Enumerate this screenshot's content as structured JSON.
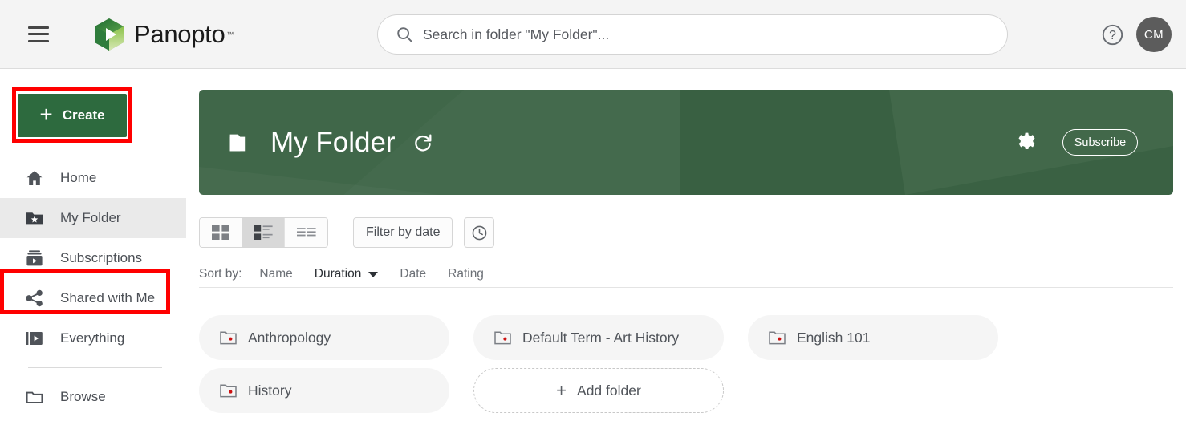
{
  "header": {
    "menu_icon": "hamburger-menu-icon",
    "brand_name": "Panopto",
    "brand_tm": "™",
    "search_placeholder": "Search in folder \"My Folder\"...",
    "search_value": "",
    "search_icon": "search-icon",
    "help_icon": "help-circle-icon",
    "avatar_initials": "CM"
  },
  "sidebar": {
    "create_label": "Create",
    "items": [
      {
        "label": "Home",
        "icon": "home-icon",
        "selected": false
      },
      {
        "label": "My Folder",
        "icon": "folder-star-icon",
        "selected": true
      },
      {
        "label": "Subscriptions",
        "icon": "subscriptions-icon",
        "selected": false
      },
      {
        "label": "Shared with Me",
        "icon": "share-icon",
        "selected": false
      },
      {
        "label": "Everything",
        "icon": "video-library-icon",
        "selected": false
      },
      {
        "label": "Browse",
        "icon": "folder-icon",
        "selected": false
      }
    ]
  },
  "banner": {
    "folder_icon": "folder-icon",
    "title": "My Folder",
    "refresh_icon": "refresh-icon",
    "settings_icon": "gear-icon",
    "subscribe_label": "Subscribe",
    "background_color": "#3c6445"
  },
  "toolbar": {
    "views": [
      {
        "name": "grid-view",
        "icon": "grid-view-icon",
        "active": false
      },
      {
        "name": "card-view",
        "icon": "card-view-icon",
        "active": true
      },
      {
        "name": "list-view",
        "icon": "list-view-icon",
        "active": false
      }
    ],
    "filter_label": "Filter by date",
    "clock_icon": "clock-icon"
  },
  "sort": {
    "label": "Sort by:",
    "options": [
      {
        "label": "Name",
        "active": false
      },
      {
        "label": "Duration",
        "active": true
      },
      {
        "label": "Date",
        "active": false
      },
      {
        "label": "Rating",
        "active": false
      }
    ]
  },
  "folders": {
    "items": [
      {
        "name": "Anthropology",
        "icon": "folder-session-icon"
      },
      {
        "name": "Default Term - Art History",
        "icon": "folder-session-icon"
      },
      {
        "name": "English 101",
        "icon": "folder-session-icon"
      },
      {
        "name": "History",
        "icon": "folder-session-icon"
      }
    ],
    "add_label": "Add folder",
    "add_icon": "plus-icon"
  },
  "annotations": {
    "color": "#ff0000",
    "boxes": [
      {
        "target": "create-button"
      },
      {
        "target": "sidebar-item-my-folder"
      }
    ]
  }
}
